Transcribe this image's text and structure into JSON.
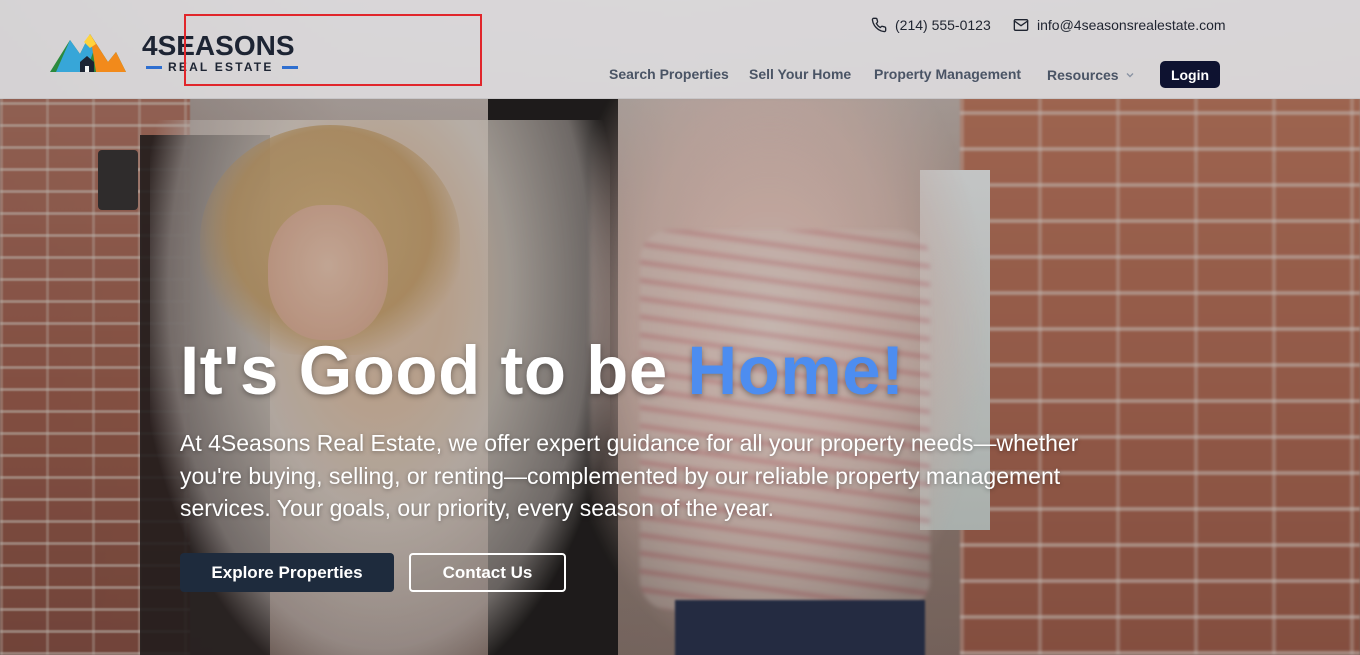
{
  "brand": {
    "logo_main": "4SEASONS",
    "logo_sub": "REAL ESTATE"
  },
  "contact": {
    "phone": "(214) 555-0123",
    "email": "info@4seasonsrealestate.com"
  },
  "nav": {
    "items": [
      {
        "label": "Search Properties"
      },
      {
        "label": "Sell Your Home"
      },
      {
        "label": "Property Management"
      },
      {
        "label": "Resources"
      }
    ],
    "login_label": "Login"
  },
  "hero": {
    "headline_prefix": "It's Good to be ",
    "headline_accent": "Home!",
    "lead": "At 4Seasons Real Estate, we offer expert guidance for all your property needs—whether you're buying, selling, or renting—complemented by our reliable property management services. Your goals, our priority, every season of the year.",
    "primary_cta": "Explore Properties",
    "secondary_cta": "Contact Us"
  },
  "colors": {
    "accent": "#4d8df0",
    "login_bg": "#0e1230",
    "primary_btn_bg": "#1e2b3d",
    "highlight_box": "#e1262b"
  },
  "icons": {
    "phone": "phone-icon",
    "email": "mail-icon",
    "dropdown": "chevron-down-icon"
  }
}
